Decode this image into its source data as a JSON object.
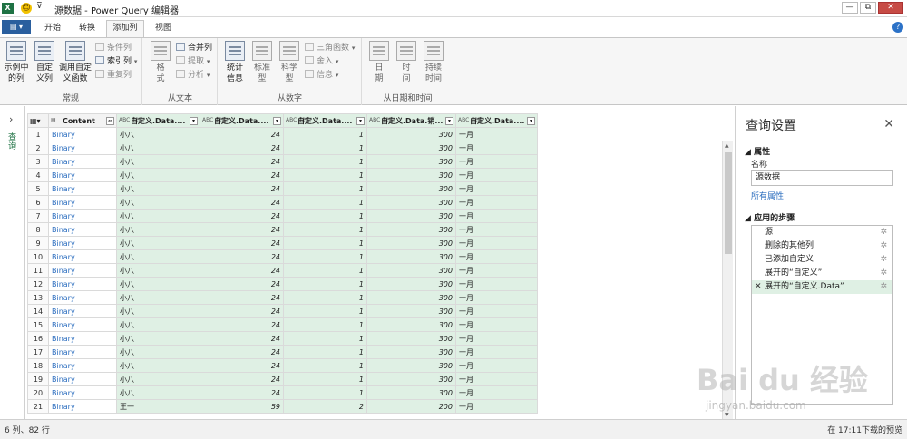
{
  "titlebar": {
    "app_icon": "X",
    "quick_access": "⊽",
    "title": "源数据 - Power Query 编辑器",
    "help": "?"
  },
  "window_controls": {
    "minimize": "—",
    "restore": "⧉",
    "close": "✕"
  },
  "tabs": [
    {
      "label": "开始"
    },
    {
      "label": "转换"
    },
    {
      "label": "添加列",
      "active": true
    },
    {
      "label": "视图"
    }
  ],
  "ribbon": {
    "groups": [
      {
        "label": "常规"
      },
      {
        "label": "从文本"
      },
      {
        "label": "从数字"
      },
      {
        "label": "从日期和时间"
      }
    ],
    "general": {
      "example_col": "示例中\n的列",
      "custom_col": "自定\n义列",
      "invoke_fn": "调用自定\n义函数",
      "conditional": "条件列",
      "index": "索引列",
      "duplicate": "重复列"
    },
    "text": {
      "format": "格\n式",
      "merge": "合并列",
      "extract": "提取",
      "parse": "分析"
    },
    "number": {
      "stats": "统计\n信息",
      "standard": "标准\n型",
      "scientific": "科学\n型",
      "trig": "三角函数",
      "rounding": "舍入",
      "info": "信息"
    },
    "datetime": {
      "date": "日\n期",
      "time": "时\n间",
      "duration": "持续\n时间"
    }
  },
  "left_pane": {
    "label": "查询",
    "arrow": "›"
  },
  "grid": {
    "columns": [
      {
        "name": "Content",
        "type": "▤"
      },
      {
        "name": "自定义.Data....",
        "type": "ABC\n123"
      },
      {
        "name": "自定义.Data....",
        "type": "ABC\n123"
      },
      {
        "name": "自定义.Data....",
        "type": "ABC\n123"
      },
      {
        "name": "自定义.Data.销...",
        "type": "ABC\n123"
      },
      {
        "name": "自定义.Data....",
        "type": "ABC\n123"
      }
    ],
    "rows": [
      {
        "n": "1",
        "content": "Binary",
        "name": "小八",
        "v1": "24",
        "v2": "1",
        "v3": "300",
        "m": "一月"
      },
      {
        "n": "2",
        "content": "Binary",
        "name": "小八",
        "v1": "24",
        "v2": "1",
        "v3": "300",
        "m": "一月"
      },
      {
        "n": "3",
        "content": "Binary",
        "name": "小八",
        "v1": "24",
        "v2": "1",
        "v3": "300",
        "m": "一月"
      },
      {
        "n": "4",
        "content": "Binary",
        "name": "小八",
        "v1": "24",
        "v2": "1",
        "v3": "300",
        "m": "一月"
      },
      {
        "n": "5",
        "content": "Binary",
        "name": "小八",
        "v1": "24",
        "v2": "1",
        "v3": "300",
        "m": "一月"
      },
      {
        "n": "6",
        "content": "Binary",
        "name": "小八",
        "v1": "24",
        "v2": "1",
        "v3": "300",
        "m": "一月"
      },
      {
        "n": "7",
        "content": "Binary",
        "name": "小八",
        "v1": "24",
        "v2": "1",
        "v3": "300",
        "m": "一月"
      },
      {
        "n": "8",
        "content": "Binary",
        "name": "小八",
        "v1": "24",
        "v2": "1",
        "v3": "300",
        "m": "一月"
      },
      {
        "n": "9",
        "content": "Binary",
        "name": "小八",
        "v1": "24",
        "v2": "1",
        "v3": "300",
        "m": "一月"
      },
      {
        "n": "10",
        "content": "Binary",
        "name": "小八",
        "v1": "24",
        "v2": "1",
        "v3": "300",
        "m": "一月"
      },
      {
        "n": "11",
        "content": "Binary",
        "name": "小八",
        "v1": "24",
        "v2": "1",
        "v3": "300",
        "m": "一月"
      },
      {
        "n": "12",
        "content": "Binary",
        "name": "小八",
        "v1": "24",
        "v2": "1",
        "v3": "300",
        "m": "一月"
      },
      {
        "n": "13",
        "content": "Binary",
        "name": "小八",
        "v1": "24",
        "v2": "1",
        "v3": "300",
        "m": "一月"
      },
      {
        "n": "14",
        "content": "Binary",
        "name": "小八",
        "v1": "24",
        "v2": "1",
        "v3": "300",
        "m": "一月"
      },
      {
        "n": "15",
        "content": "Binary",
        "name": "小八",
        "v1": "24",
        "v2": "1",
        "v3": "300",
        "m": "一月"
      },
      {
        "n": "16",
        "content": "Binary",
        "name": "小八",
        "v1": "24",
        "v2": "1",
        "v3": "300",
        "m": "一月"
      },
      {
        "n": "17",
        "content": "Binary",
        "name": "小八",
        "v1": "24",
        "v2": "1",
        "v3": "300",
        "m": "一月"
      },
      {
        "n": "18",
        "content": "Binary",
        "name": "小八",
        "v1": "24",
        "v2": "1",
        "v3": "300",
        "m": "一月"
      },
      {
        "n": "19",
        "content": "Binary",
        "name": "小八",
        "v1": "24",
        "v2": "1",
        "v3": "300",
        "m": "一月"
      },
      {
        "n": "20",
        "content": "Binary",
        "name": "小八",
        "v1": "24",
        "v2": "1",
        "v3": "300",
        "m": "一月"
      },
      {
        "n": "21",
        "content": "Binary",
        "name": "王一",
        "v1": "59",
        "v2": "2",
        "v3": "200",
        "m": "一月"
      }
    ]
  },
  "settings": {
    "title": "查询设置",
    "close": "✕",
    "properties_header": "属性",
    "name_label": "名称",
    "name_value": "源数据",
    "all_properties": "所有属性",
    "steps_header": "应用的步骤",
    "steps": [
      {
        "label": "源"
      },
      {
        "label": "删除的其他列"
      },
      {
        "label": "已添加自定义"
      },
      {
        "label": "展开的“自定义”"
      },
      {
        "label": "展开的“自定义.Data”",
        "selected": true
      }
    ]
  },
  "status": {
    "left": "6 列、82 行",
    "right": "在 17:11下载的预览"
  },
  "watermark": {
    "brand": "Bai du 经验",
    "url": "jingyan.baidu.com"
  }
}
